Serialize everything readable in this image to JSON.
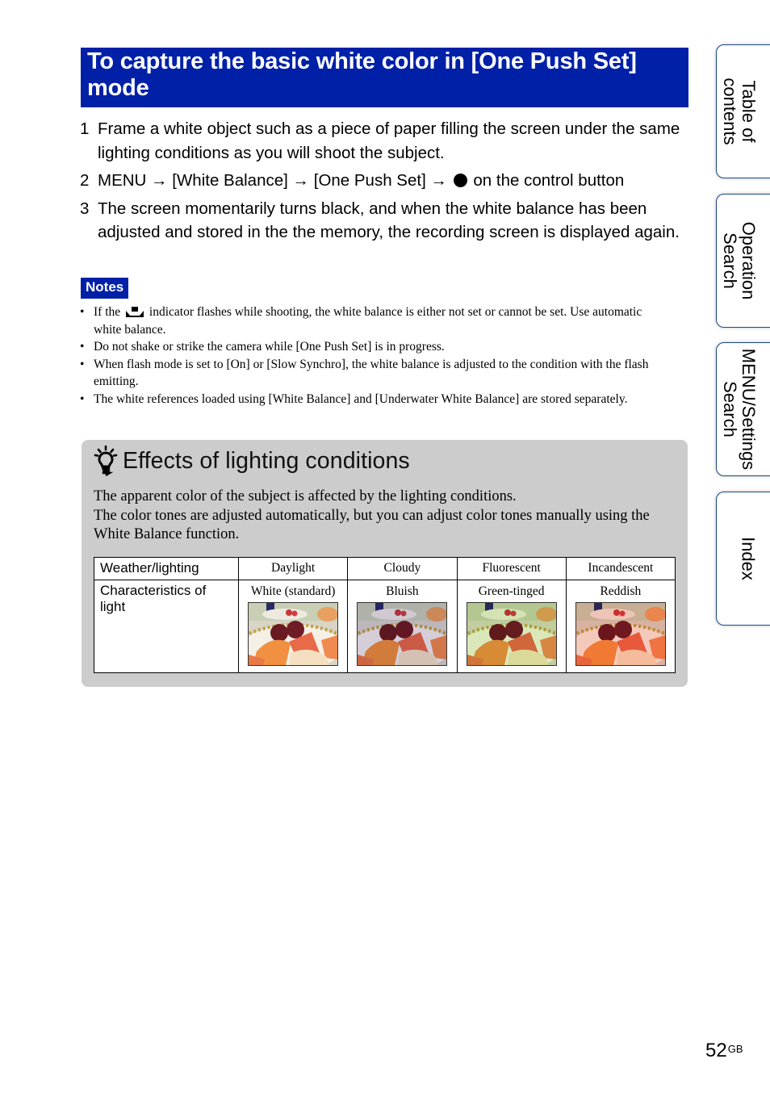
{
  "title": "To capture the basic white color in [One Push Set] mode",
  "steps": [
    {
      "num": "1",
      "text": "Frame a white object such as a piece of paper filling the screen under the same lighting conditions as you will shoot the subject."
    },
    {
      "num": "2",
      "parts": {
        "a": "MENU",
        "b": "[White Balance]",
        "c": "[One Push Set]",
        "d": "on the control button"
      },
      "arrow": "→"
    },
    {
      "num": "3",
      "text": "The screen momentarily turns black, and when the white balance has been adjusted and stored in the the memory, the recording screen is displayed again."
    }
  ],
  "notes": {
    "label": "Notes",
    "bullet": "•",
    "items": [
      {
        "before": "If the",
        "icon": "white-balance-indicator-icon",
        "after": "indicator flashes while shooting, the white balance is either not set or cannot be set. Use automatic white balance."
      },
      {
        "text": "Do not shake or strike the camera while [One Push Set] is in progress."
      },
      {
        "text": "When flash mode is set to [On] or [Slow Synchro], the white balance is adjusted to the condition with the flash emitting."
      },
      {
        "text": "The white references loaded using [White Balance] and [Underwater White Balance] are stored separately."
      }
    ]
  },
  "hint": {
    "icon": "lightbulb-hint-icon",
    "title": "Effects of lighting conditions",
    "body_line1": "The apparent color of the subject is affected by the lighting conditions.",
    "body_line2": "The color tones are adjusted automatically, but you can adjust color tones manually using the White Balance function.",
    "table": {
      "row_headers": [
        "Weather/lighting",
        "Characteristics of light"
      ],
      "columns": [
        {
          "condition": "Daylight",
          "characteristic": "White (standard)",
          "tint": "#ffffff"
        },
        {
          "condition": "Cloudy",
          "characteristic": "Bluish",
          "tint": "#8a7cc8"
        },
        {
          "condition": "Fluorescent",
          "characteristic": "Green-tinged",
          "tint": "#9ee04a"
        },
        {
          "condition": "Incandescent",
          "characteristic": "Reddish",
          "tint": "#ff6a50"
        }
      ]
    }
  },
  "side_tabs": [
    {
      "label_line1": "Table of",
      "label_line2": "contents"
    },
    {
      "label_line1": "Operation",
      "label_line2": "Search"
    },
    {
      "label_line1": "MENU/Settings",
      "label_line2": "Search"
    },
    {
      "label_line1": "Index",
      "label_line2": ""
    }
  ],
  "page": {
    "number": "52",
    "suffix": "GB"
  },
  "colors": {
    "accent_blue": "#0020a8",
    "hint_bg": "#cccccc",
    "tab_border": "#1d4a8a"
  }
}
